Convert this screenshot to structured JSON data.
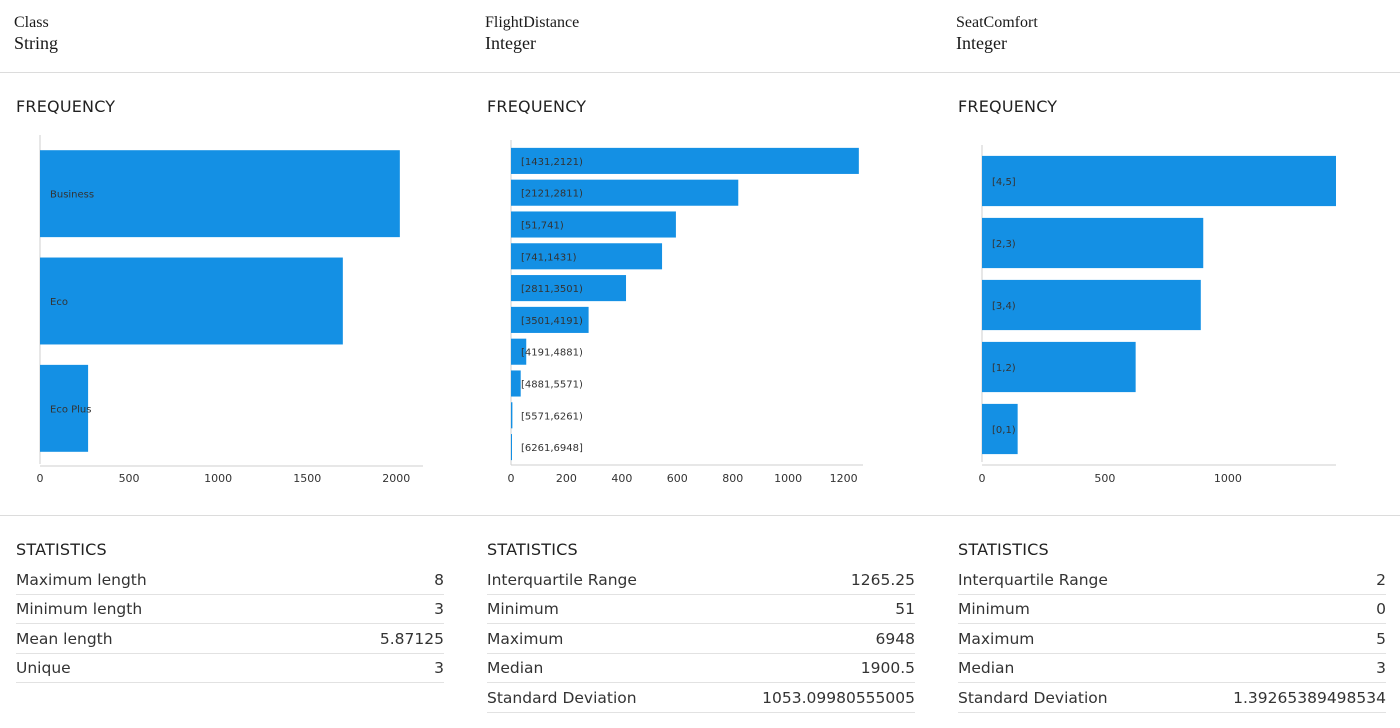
{
  "columns": [
    {
      "name": "Class",
      "type": "String",
      "frequency_title": "FREQUENCY",
      "statistics_title": "STATISTICS",
      "statistics": [
        {
          "label": "Maximum length",
          "value": "8"
        },
        {
          "label": "Minimum length",
          "value": "3"
        },
        {
          "label": "Mean length",
          "value": "5.87125"
        },
        {
          "label": "Unique",
          "value": "3"
        }
      ]
    },
    {
      "name": "FlightDistance",
      "type": "Integer",
      "frequency_title": "FREQUENCY",
      "statistics_title": "STATISTICS",
      "statistics": [
        {
          "label": "Interquartile Range",
          "value": "1265.25"
        },
        {
          "label": "Minimum",
          "value": "51"
        },
        {
          "label": "Maximum",
          "value": "6948"
        },
        {
          "label": "Median",
          "value": "1900.5"
        },
        {
          "label": "Standard Deviation",
          "value": "1053.09980555005"
        }
      ]
    },
    {
      "name": "SeatComfort",
      "type": "Integer",
      "frequency_title": "FREQUENCY",
      "statistics_title": "STATISTICS",
      "statistics": [
        {
          "label": "Interquartile Range",
          "value": "2"
        },
        {
          "label": "Minimum",
          "value": "0"
        },
        {
          "label": "Maximum",
          "value": "5"
        },
        {
          "label": "Median",
          "value": "3"
        },
        {
          "label": "Standard Deviation",
          "value": "1.39265389498534"
        }
      ]
    }
  ],
  "colors": {
    "bar": "#1490e4"
  },
  "chart_data": [
    {
      "type": "bar",
      "orientation": "horizontal",
      "title": "FREQUENCY",
      "categories": [
        "Business",
        "Eco",
        "Eco Plus"
      ],
      "values": [
        2020,
        1700,
        270
      ],
      "xlim": [
        0,
        2150
      ],
      "xticks": [
        0,
        500,
        1000,
        1500,
        2000
      ],
      "tick_labels": [
        "0",
        "500",
        "1000",
        "1500",
        "2000"
      ]
    },
    {
      "type": "bar",
      "orientation": "horizontal",
      "title": "FREQUENCY",
      "categories": [
        "[1431,2121)",
        "[2121,2811)",
        "[51,741)",
        "[741,1431)",
        "[2811,3501)",
        "[3501,4191)",
        "[4191,4881)",
        "[4881,5571)",
        "[5571,6261)",
        "[6261,6948]"
      ],
      "values": [
        1255,
        820,
        595,
        545,
        415,
        280,
        55,
        35,
        5,
        2
      ],
      "xlim": [
        0,
        1270
      ],
      "xticks": [
        0,
        200,
        400,
        600,
        800,
        1000,
        1200
      ],
      "tick_labels": [
        "0",
        "200",
        "400",
        "600",
        "800",
        "1000",
        "1200"
      ]
    },
    {
      "type": "bar",
      "orientation": "horizontal",
      "title": "FREQUENCY",
      "categories": [
        "[4,5]",
        "[2,3)",
        "[3,4)",
        "[1,2)",
        "[0,1)"
      ],
      "values": [
        1440,
        900,
        890,
        625,
        145
      ],
      "xlim": [
        0,
        1440
      ],
      "xticks": [
        0,
        500,
        1000
      ],
      "tick_labels": [
        "0",
        "500",
        "1000"
      ]
    }
  ]
}
